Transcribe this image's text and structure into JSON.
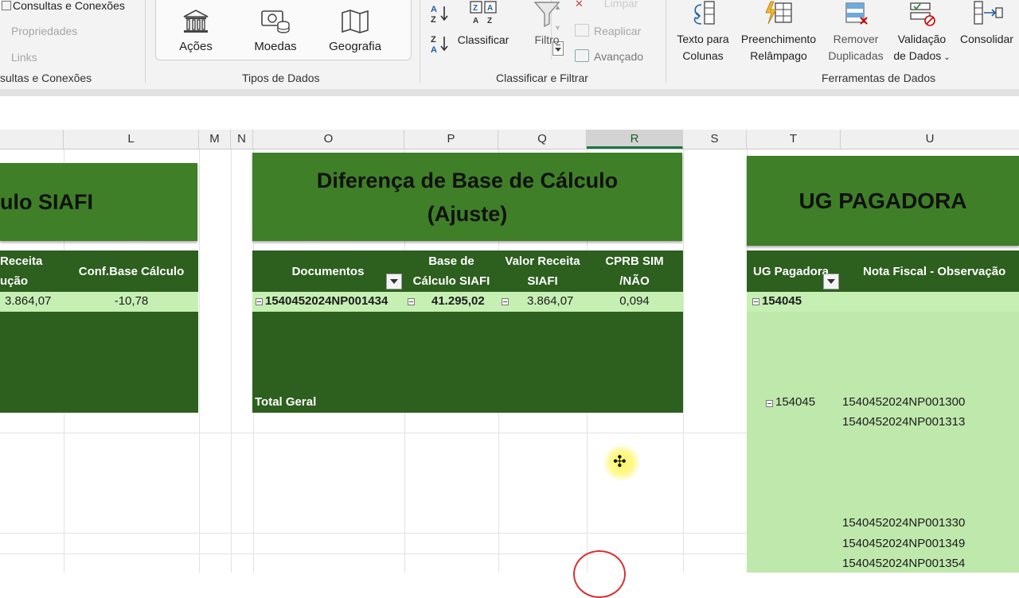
{
  "ribbon": {
    "queries": {
      "item1": "Consultas e Conexões",
      "item2": "Propriedades",
      "item3": "Links",
      "group": "Consultas e Conexões",
      "group_visible": "sultas e Conexões"
    },
    "data_types": {
      "buttons": [
        "Ações",
        "Moedas",
        "Geografia"
      ],
      "group": "Tipos de Dados"
    },
    "sort_filter": {
      "sort": "Classificar",
      "filter": "Filtro",
      "clear": "Limpar",
      "reapply": "Reaplicar",
      "advanced": "Avançado",
      "group": "Classificar e Filtrar"
    },
    "data_tools": {
      "text_to_columns": [
        "Texto para",
        "Colunas"
      ],
      "flash_fill": [
        "Preenchimento",
        "Relâmpago"
      ],
      "remove_duplicates": [
        "Remover",
        "Duplicadas"
      ],
      "validation": [
        "Validação",
        "de Dados"
      ],
      "consolidate": "Consolidar",
      "group": "Ferramentas de Dados"
    }
  },
  "columns": [
    "L",
    "M",
    "N",
    "O",
    "P",
    "Q",
    "R",
    "S",
    "T",
    "U"
  ],
  "selected_column": "R",
  "siafi_block": {
    "title_visible": "ulo SIAFI",
    "headers": {
      "receita": [
        "Receita",
        "ução"
      ],
      "conf": "Conf.Base Cálculo"
    },
    "row": {
      "receita": "3.864,07",
      "conf": "-10,78"
    }
  },
  "diff_block": {
    "title": [
      "Diferença de Base de Cálculo",
      "(Ajuste)"
    ],
    "headers": {
      "documentos": "Documentos",
      "base": [
        "Base de",
        "Cálculo SIAFI"
      ],
      "valor": [
        "Valor Receita",
        "SIAFI"
      ],
      "cprb": [
        "CPRB SIM",
        "/NÃO"
      ]
    },
    "row": {
      "documento": "1540452024NP001434",
      "base": "41.295,02",
      "valor": "3.864,07",
      "cprb": "0,094"
    },
    "total_label": "Total Geral"
  },
  "ug_block": {
    "title": "UG PAGADORA",
    "headers": {
      "ug": "UG Pagadora",
      "nota": "Nota Fiscal - Observação"
    },
    "row1_ug": "154045",
    "row2_ug": "154045",
    "notes": [
      "1540452024NP001300",
      "1540452024NP001313",
      "1540452024NP001330",
      "1540452024NP001349",
      "1540452024NP001354"
    ]
  },
  "colors": {
    "dark_green": "#2d5f1f",
    "title_green": "#3f7f28",
    "light_green": "#c6efb4",
    "selected_header": "#1e7145"
  }
}
